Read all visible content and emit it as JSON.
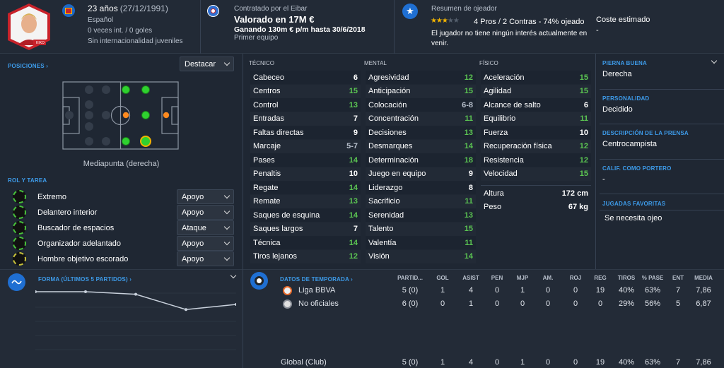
{
  "profile": {
    "age": "23 años",
    "dob": "(27/12/1991)",
    "nationality": "Español",
    "caps": "0 veces int. / 0 goles",
    "youth": "Sin internacionalidad juveniles",
    "photo_tag": "KIKO"
  },
  "contract": {
    "label": "Contratado por el Eibar",
    "value": "Valorado en 17M €",
    "wage": "Ganando 130m € p/m hasta 30/6/2018",
    "status": "Primer equipo"
  },
  "scout": {
    "title": "Resumen de ojeador",
    "stars": 3,
    "stars_max": 5,
    "summary": "4 Pros / 2 Contras - 74% ojeado",
    "note": "El jugador no tiene ningún interés actualmente en venir.",
    "cost_label": "Coste estimado",
    "cost_value": "-"
  },
  "positions": {
    "title": "POSICIONES ›",
    "highlight_label": "Destacar",
    "position_name": "Mediapunta (derecha)"
  },
  "roles": {
    "title": "ROL Y TAREA",
    "items": [
      {
        "name": "Extremo",
        "duty": "Apoyo",
        "color": "#48c23a"
      },
      {
        "name": "Delantero interior",
        "duty": "Apoyo",
        "color": "#48c23a"
      },
      {
        "name": "Buscador de espacios",
        "duty": "Ataque",
        "color": "#48c23a"
      },
      {
        "name": "Organizador adelantado",
        "duty": "Apoyo",
        "color": "#48c23a"
      },
      {
        "name": "Hombre objetivo escorado",
        "duty": "Apoyo",
        "color": "#c8c23a"
      }
    ]
  },
  "attributes": {
    "technical_title": "TÉCNICO",
    "mental_title": "MENTAL",
    "physical_title": "FÍSICO",
    "technical": [
      {
        "name": "Cabeceo",
        "value": "6"
      },
      {
        "name": "Centros",
        "value": "15"
      },
      {
        "name": "Control",
        "value": "13"
      },
      {
        "name": "Entradas",
        "value": "7"
      },
      {
        "name": "Faltas directas",
        "value": "9"
      },
      {
        "name": "Marcaje",
        "value": "5-7"
      },
      {
        "name": "Pases",
        "value": "14"
      },
      {
        "name": "Penaltis",
        "value": "10"
      },
      {
        "name": "Regate",
        "value": "14"
      },
      {
        "name": "Remate",
        "value": "13"
      },
      {
        "name": "Saques de esquina",
        "value": "14"
      },
      {
        "name": "Saques largos",
        "value": "7"
      },
      {
        "name": "Técnica",
        "value": "14"
      },
      {
        "name": "Tiros lejanos",
        "value": "12"
      }
    ],
    "mental": [
      {
        "name": "Agresividad",
        "value": "12"
      },
      {
        "name": "Anticipación",
        "value": "15"
      },
      {
        "name": "Colocación",
        "value": "6-8"
      },
      {
        "name": "Concentración",
        "value": "11"
      },
      {
        "name": "Decisiones",
        "value": "13"
      },
      {
        "name": "Desmarques",
        "value": "14"
      },
      {
        "name": "Determinación",
        "value": "18"
      },
      {
        "name": "Juego en equipo",
        "value": "9"
      },
      {
        "name": "Liderazgo",
        "value": "8"
      },
      {
        "name": "Sacrificio",
        "value": "11"
      },
      {
        "name": "Serenidad",
        "value": "13"
      },
      {
        "name": "Talento",
        "value": "15"
      },
      {
        "name": "Valentía",
        "value": "11"
      },
      {
        "name": "Visión",
        "value": "14"
      }
    ],
    "physical": [
      {
        "name": "Aceleración",
        "value": "15"
      },
      {
        "name": "Agilidad",
        "value": "15"
      },
      {
        "name": "Alcance de salto",
        "value": "6"
      },
      {
        "name": "Equilibrio",
        "value": "11"
      },
      {
        "name": "Fuerza",
        "value": "10"
      },
      {
        "name": "Recuperación física",
        "value": "12"
      },
      {
        "name": "Resistencia",
        "value": "12"
      },
      {
        "name": "Velocidad",
        "value": "15"
      }
    ],
    "height_label": "Altura",
    "height_value": "172 cm",
    "weight_label": "Peso",
    "weight_value": "67 kg"
  },
  "side": {
    "foot_label": "PIERNA BUENA",
    "foot_value": "Derecha",
    "personality_label": "PERSONALIDAD",
    "personality_value": "Decidido",
    "press_label": "DESCRIPCIÓN DE LA PRENSA",
    "press_value": "Centrocampista",
    "gk_label": "CALIF. COMO PORTERO",
    "gk_value": "-",
    "moves_label": "JUGADAS FAVORITAS",
    "moves_value": "Se necesita ojeo"
  },
  "form": {
    "title": "FORMA (ÚLTIMOS 5 PARTIDOS) ›",
    "ratings": [
      7.0,
      7.0,
      6.9,
      6.3,
      6.5
    ]
  },
  "season": {
    "title": "DATOS DE TEMPORADA ›",
    "columns": [
      "PARTID...",
      "GOL",
      "ASIST",
      "PEN",
      "MJP",
      "AM.",
      "ROJ",
      "REG",
      "TIROS",
      "% PASE",
      "ENT",
      "MEDIA"
    ],
    "rows": [
      {
        "name": "Liga BBVA",
        "cells": [
          "5 (0)",
          "1",
          "4",
          "0",
          "1",
          "0",
          "0",
          "19",
          "40%",
          "63%",
          "7",
          "7,86"
        ]
      },
      {
        "name": "No oficiales",
        "cells": [
          "6 (0)",
          "0",
          "1",
          "0",
          "0",
          "0",
          "0",
          "0",
          "29%",
          "56%",
          "5",
          "6,87"
        ]
      }
    ],
    "total": {
      "name": "Global (Club)",
      "cells": [
        "5 (0)",
        "1",
        "4",
        "0",
        "1",
        "0",
        "0",
        "19",
        "40%",
        "63%",
        "7",
        "7,86"
      ]
    }
  },
  "colors": {
    "bg": "#1f2733",
    "accent": "#3d9be9",
    "good": "#5bc552",
    "key_position": "#2fd12f",
    "secondary_position": "#ff8a1f"
  }
}
